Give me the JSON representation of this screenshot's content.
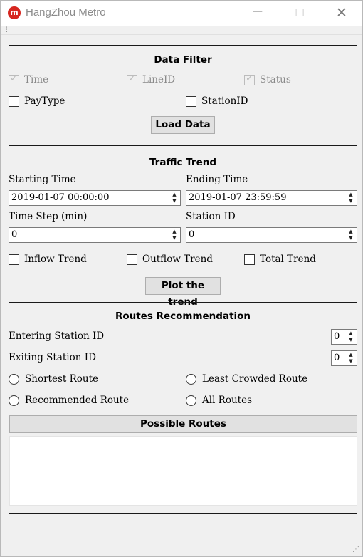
{
  "window": {
    "title": "HangZhou Metro",
    "icon": "metro-logo-icon",
    "controls": {
      "minimize": "—",
      "maximize": "☐",
      "close": "✕"
    }
  },
  "data_filter": {
    "title": "Data Filter",
    "checkboxes": [
      {
        "label": "Time",
        "checked": true,
        "disabled": true
      },
      {
        "label": "LineID",
        "checked": true,
        "disabled": true
      },
      {
        "label": "Status",
        "checked": true,
        "disabled": true
      },
      {
        "label": "PayType",
        "checked": false,
        "disabled": false
      },
      {
        "label": "StationID",
        "checked": false,
        "disabled": false
      }
    ],
    "load_button": "Load Data"
  },
  "traffic_trend": {
    "title": "Traffic Trend",
    "starting_time_label": "Starting Time",
    "starting_time_value": "2019-01-07 00:00:00",
    "ending_time_label": "Ending Time",
    "ending_time_value": "2019-01-07 23:59:59",
    "time_step_label": "Time Step (min)",
    "time_step_value": "0",
    "station_id_label": "Station ID",
    "station_id_value": "0",
    "trend_checkboxes": [
      {
        "label": "Inflow Trend",
        "checked": false
      },
      {
        "label": "Outflow Trend",
        "checked": false
      },
      {
        "label": "Total Trend",
        "checked": false
      }
    ],
    "plot_button": "Plot the trend"
  },
  "routes": {
    "title": "Routes Recommendation",
    "entering_label": "Entering Station ID",
    "entering_value": "0",
    "exiting_label": "Exiting Station ID",
    "exiting_value": "0",
    "options": [
      {
        "label": "Shortest Route",
        "selected": false
      },
      {
        "label": "Least Crowded Route",
        "selected": false
      },
      {
        "label": "Recommended Route",
        "selected": false
      },
      {
        "label": "All Routes",
        "selected": false
      }
    ],
    "possible_routes_header": "Possible Routes"
  }
}
